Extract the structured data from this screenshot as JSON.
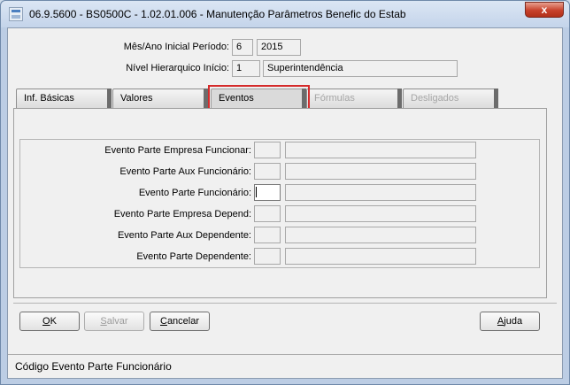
{
  "window": {
    "title": "06.9.5600 - BS0500C - 1.02.01.006 - Manutenção Parâmetros Benefic do Estab",
    "close_glyph": "x"
  },
  "header": {
    "period_label": "Mês/Ano Inicial Período:",
    "period_month": "6",
    "period_year": "2015",
    "level_label": "Nível Hierarquico Início:",
    "level_code": "1",
    "level_name": "Superintendência"
  },
  "tabs": [
    {
      "label": "Inf. Básicas",
      "state": "enabled"
    },
    {
      "label": "Valores",
      "state": "enabled"
    },
    {
      "label": "Eventos",
      "state": "active"
    },
    {
      "label": "Fórmulas",
      "state": "disabled"
    },
    {
      "label": "Desligados",
      "state": "disabled"
    }
  ],
  "eventos": {
    "fields": [
      {
        "label": "Evento Parte Empresa Funcionar:",
        "code": "",
        "description": ""
      },
      {
        "label": "Evento Parte Aux Funcionário:",
        "code": "",
        "description": ""
      },
      {
        "label": "Evento Parte Funcionário:",
        "code": "",
        "description": ""
      },
      {
        "label": "Evento Parte Empresa Depend:",
        "code": "",
        "description": ""
      },
      {
        "label": "Evento Parte Aux Dependente:",
        "code": "",
        "description": ""
      },
      {
        "label": "Evento Parte Dependente:",
        "code": "",
        "description": ""
      }
    ]
  },
  "buttons": {
    "ok": {
      "mnemonic": "O",
      "rest": "K"
    },
    "salvar": {
      "mnemonic": "S",
      "rest": "alvar"
    },
    "cancelar": {
      "mnemonic": "C",
      "rest": "ancelar"
    },
    "ajuda": {
      "mnemonic": "A",
      "rest": "juda"
    }
  },
  "status": {
    "text": "Código Evento Parte Funcionário"
  },
  "colors": {
    "highlight": "#d52b2b",
    "title_bar": "#c4d4ea",
    "close_button": "#c7412b"
  }
}
